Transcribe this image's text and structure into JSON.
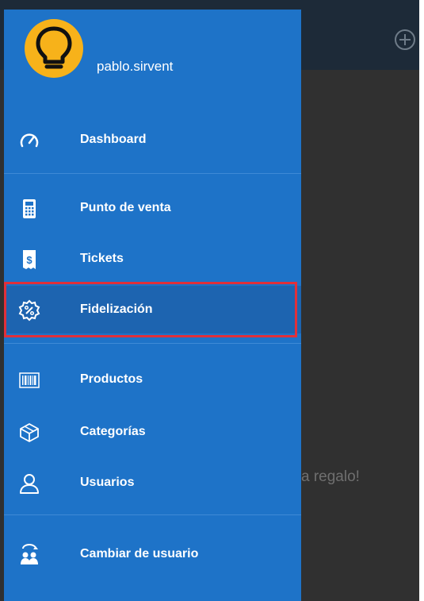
{
  "background": {
    "partial_text": "a regalo!"
  },
  "profile": {
    "username": "pablo.sirvent",
    "avatar_icon": "lightbulb-icon"
  },
  "menu": {
    "items": [
      {
        "label": "Dashboard",
        "icon": "speedometer-icon"
      },
      {
        "label": "Punto de venta",
        "icon": "calculator-icon"
      },
      {
        "label": "Tickets",
        "icon": "receipt-icon"
      },
      {
        "label": "Fidelización",
        "icon": "percent-badge-icon",
        "selected": true
      },
      {
        "label": "Productos",
        "icon": "barcode-icon"
      },
      {
        "label": "Categorías",
        "icon": "box-icon"
      },
      {
        "label": "Usuarios",
        "icon": "user-icon"
      },
      {
        "label": "Cambiar de usuario",
        "icon": "switch-user-icon"
      }
    ]
  },
  "colors": {
    "drawer": "#1e73c8",
    "selected": "#1d64b0",
    "highlight_border": "#e0303a",
    "avatar": "#f7b21a"
  }
}
